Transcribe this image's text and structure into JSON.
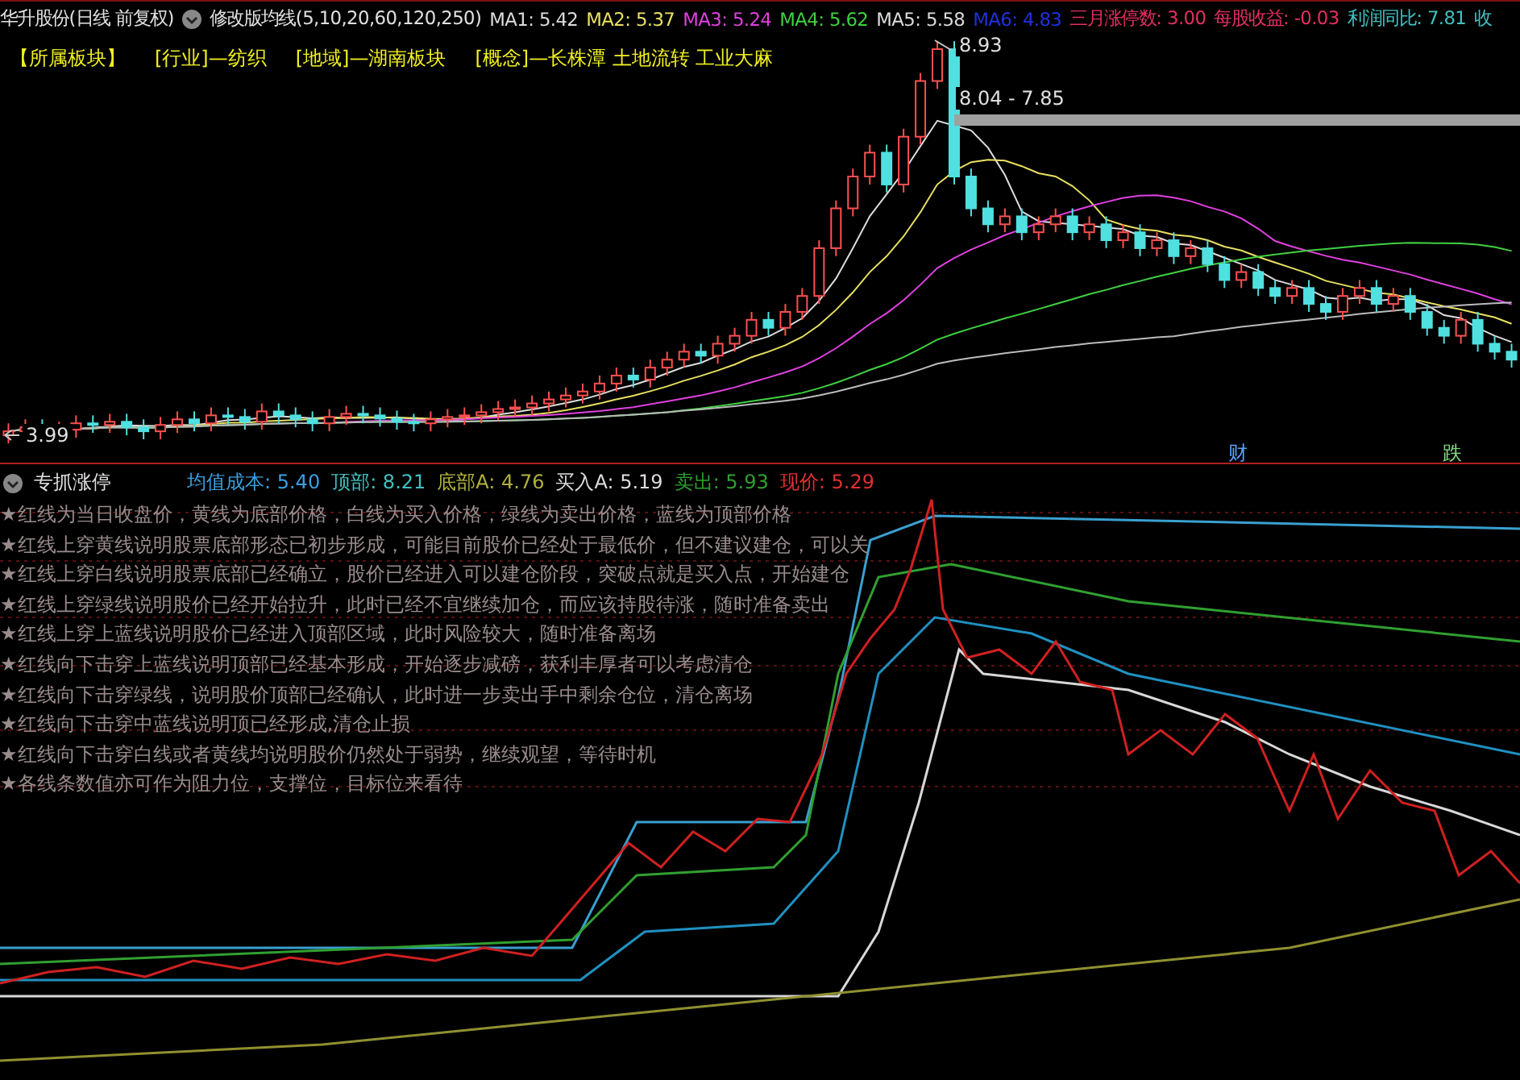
{
  "header": {
    "stock": "华升股份(日线 前复权)",
    "indicator": "修改版均线(5,10,20,60,120,250)",
    "values": [
      {
        "label": "MA1:",
        "value": "5.42",
        "color": "#dcdcdc"
      },
      {
        "label": "MA2:",
        "value": "5.37",
        "color": "#e8e060"
      },
      {
        "label": "MA3:",
        "value": "5.24",
        "color": "#e040e0"
      },
      {
        "label": "MA4:",
        "value": "5.62",
        "color": "#40d040"
      },
      {
        "label": "MA5:",
        "value": "5.58",
        "color": "#dcdcdc"
      },
      {
        "label": "MA6:",
        "value": "4.83",
        "color": "#2030e0"
      },
      {
        "label": "三月涨停数:",
        "value": "3.00",
        "color": "#e03060"
      },
      {
        "label": "每股收益:",
        "value": "-0.03",
        "color": "#e03060"
      },
      {
        "label": "利润同比:",
        "value": "7.81",
        "color": "#40c0c0"
      }
    ],
    "trailing": {
      "label": "收",
      "color": "#40c0c0"
    }
  },
  "sectors": [
    "【所属板块】",
    "[行业]—纺织",
    "[地域]—湖南板块",
    "[概念]—长株潭 土地流转 工业大麻"
  ],
  "price_chart": {
    "high_label": "8.93",
    "range_label": "8.04 - 7.85",
    "low_label": "3.99",
    "markers": [
      {
        "text": "财",
        "color": "#5aa0ff"
      },
      {
        "text": "跌",
        "color": "#80e080"
      }
    ]
  },
  "indicator_panel": {
    "title": "专抓涨停",
    "values": [
      {
        "label": "均值成本:",
        "value": "5.40",
        "color": "#3aa0e0"
      },
      {
        "label": "顶部:",
        "value": "8.21",
        "color": "#40c0c0"
      },
      {
        "label": "底部A:",
        "value": "4.76",
        "color": "#b0b040"
      },
      {
        "label": "买入A:",
        "value": "5.19",
        "color": "#dcdcdc"
      },
      {
        "label": "卖出:",
        "value": "5.93",
        "color": "#30a030"
      },
      {
        "label": "现价:",
        "value": "5.29",
        "color": "#e03030"
      }
    ],
    "notes": [
      "★红线为当日收盘价，黄线为底部价格，白线为买入价格，绿线为卖出价格，蓝线为顶部价格",
      "★红线上穿黄线说明股票底部形态已初步形成，可能目前股价已经处于最低价，但不建议建仓，可以关",
      "★红线上穿白线说明股票底部已经确立，股价已经进入可以建仓阶段，突破点就是买入点，开始建仓",
      "★红线上穿绿线说明股价已经开始拉升，此时已经不宜继续加仓，而应该持股待涨，随时准备卖出",
      "★红线上穿上蓝线说明股价已经进入顶部区域，此时风险较大，随时准备离场",
      "★红线向下击穿上蓝线说明顶部已经基本形成，开始逐步减磅，获利丰厚者可以考虑清仓",
      "★红线向下击穿绿线，说明股价顶部已经确认，此时进一步卖出手中剩余仓位，清仓离场",
      "★红线向下击穿中蓝线说明顶已经形成,清仓止损",
      "★红线向下击穿白线或者黄线均说明股价仍然处于弱势，继续观望，等待时机",
      "★各线条数值亦可作为阻力位，支撑位，目标位来看待"
    ]
  }
}
